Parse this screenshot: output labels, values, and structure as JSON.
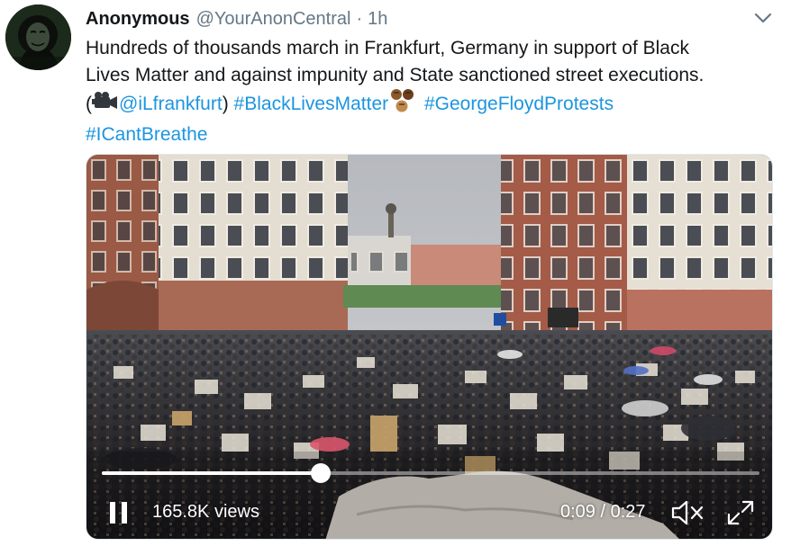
{
  "tweet": {
    "display_name": "Anonymous",
    "handle": "@YourAnonCentral",
    "separator": "·",
    "time": "1h",
    "text_line1": "Hundreds of thousands march in Frankfurt, Germany in support of Black",
    "text_line2": "Lives Matter and against impunity and State sanctioned street executions.",
    "paren_open": "(",
    "mention": "@iLfrankfurt",
    "paren_close": ")",
    "hashtags": [
      "#BlackLivesMatter",
      "#GeorgeFloydProtests",
      "#ICantBreathe"
    ]
  },
  "video": {
    "views": "165.8K views",
    "current_time": "0:09",
    "time_separator": "/",
    "duration": "0:27",
    "progress_fraction": 0.333
  },
  "icons": {
    "avatar": "anonymous-mask-avatar",
    "menu": "chevron-down-icon",
    "camera": "movie-camera-emoji",
    "fists": "raised-fists-emoji",
    "pause": "pause-icon",
    "volume": "muted-speaker-icon",
    "fullscreen": "fullscreen-icon"
  },
  "colors": {
    "link": "#1b95e0",
    "text": "#14171a",
    "secondary": "#657786"
  }
}
